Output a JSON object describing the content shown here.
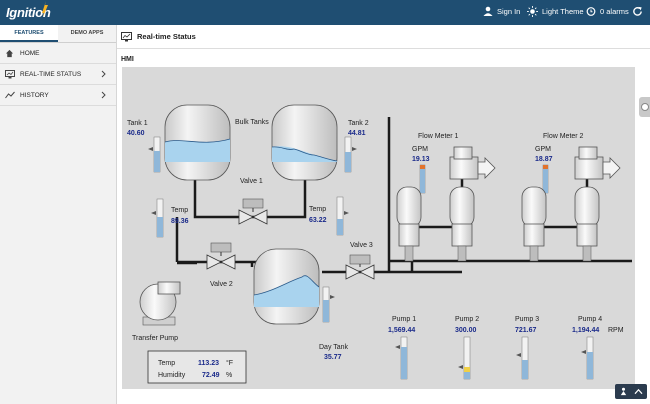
{
  "app": {
    "brand": "Ignition",
    "sign_in": "Sign In",
    "theme": "Light Theme",
    "alarms": "0 alarms"
  },
  "sidebar": {
    "tabs": [
      {
        "label": "FEATURES"
      },
      {
        "label": "DEMO APPS"
      }
    ],
    "items": [
      {
        "label": "HOME"
      },
      {
        "label": "REAL-TIME STATUS"
      },
      {
        "label": "HISTORY"
      }
    ]
  },
  "page": {
    "title": "Real-time Status",
    "section": "HMI"
  },
  "hmi": {
    "bulk_tanks_label": "Bulk Tanks",
    "tank1": {
      "label": "Tank 1",
      "value": "40.60"
    },
    "tank2": {
      "label": "Tank 2",
      "value": "44.81"
    },
    "temp1": {
      "label": "Temp",
      "value": "89.36"
    },
    "temp2": {
      "label": "Temp",
      "value": "63.22"
    },
    "valve1": "Valve 1",
    "valve2": "Valve 2",
    "valve3": "Valve 3",
    "transfer_pump": "Transfer Pump",
    "day_tank": {
      "label": "Day Tank",
      "value": "35.77"
    },
    "flow_meter1": {
      "label": "Flow Meter 1",
      "unit": "GPM",
      "value": "19.13"
    },
    "flow_meter2": {
      "label": "Flow Meter 2",
      "unit": "GPM",
      "value": "18.87"
    },
    "pumps": [
      {
        "label": "Pump 1",
        "value": "1,569.44"
      },
      {
        "label": "Pump 2",
        "value": "300.00"
      },
      {
        "label": "Pump 3",
        "value": "721.67"
      },
      {
        "label": "Pump 4",
        "value": "1,194.44"
      }
    ],
    "rpm_unit": "RPM",
    "ambient": {
      "temp_label": "Temp",
      "temp_value": "113.23",
      "temp_unit": "°F",
      "humidity_label": "Humidity",
      "humidity_value": "72.49",
      "humidity_unit": "%"
    }
  }
}
